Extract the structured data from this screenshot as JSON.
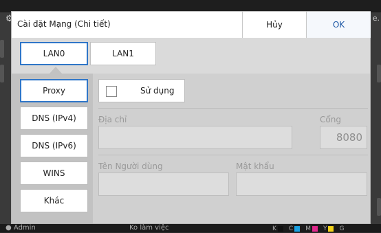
{
  "background": {
    "right_text": "e."
  },
  "dialog": {
    "title": "Cài đặt Mạng (Chi tiết)",
    "cancel_label": "Hủy",
    "ok_label": "OK"
  },
  "lan_tabs": [
    {
      "label": "LAN0",
      "active": true
    },
    {
      "label": "LAN1",
      "active": false
    }
  ],
  "sidebar": {
    "items": [
      {
        "label": "Proxy",
        "active": true
      },
      {
        "label": "DNS (IPv4)",
        "active": false
      },
      {
        "label": "DNS (IPv6)",
        "active": false
      },
      {
        "label": "WINS",
        "active": false
      },
      {
        "label": "Khác",
        "active": false
      }
    ]
  },
  "proxy": {
    "use_label": "Sử dụng",
    "use_checked": false,
    "address_label": "Địa chỉ",
    "address_value": "",
    "port_label": "Cổng",
    "port_value": "8080",
    "username_label": "Tên Người dùng",
    "username_value": "",
    "password_label": "Mật khẩu",
    "password_value": ""
  },
  "statusbar": {
    "user": "Admin",
    "state": "Ko làm việc",
    "inks": [
      "K",
      "C",
      "M",
      "Y",
      "G"
    ],
    "ink_colors": {
      "K": "#111111",
      "C": "#1aa0e0",
      "M": "#e0288c",
      "Y": "#f2d21a",
      "G": "#888888"
    }
  },
  "colors": {
    "accent": "#2f76c8",
    "ok_text": "#1c57a5"
  }
}
